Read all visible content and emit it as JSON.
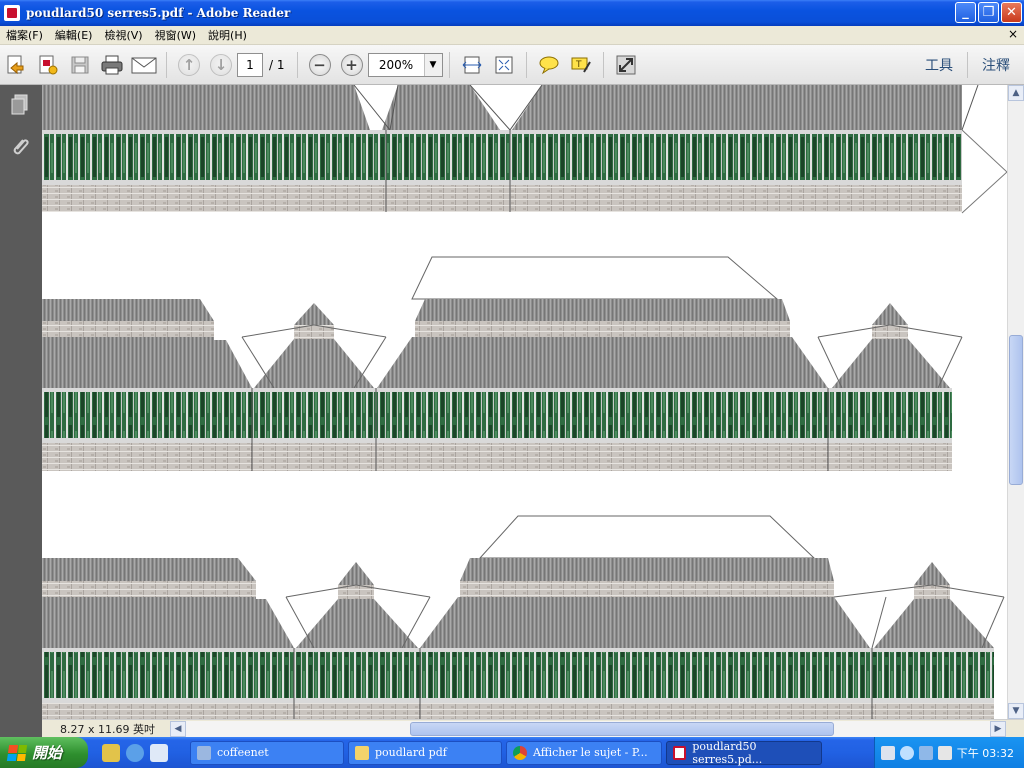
{
  "window": {
    "title": "poudlard50 serres5.pdf - Adobe Reader",
    "buttons": {
      "minimize": "_",
      "restore": "❐",
      "close": "✕"
    }
  },
  "menubar": {
    "items": [
      "檔案(F)",
      "編輯(E)",
      "檢視(V)",
      "視窗(W)",
      "說明(H)"
    ],
    "close_glyph": "×"
  },
  "toolbar": {
    "page_current": "1",
    "page_total": "/ 1",
    "zoom": "200%",
    "tools_label": "工具",
    "comment_label": "注釋"
  },
  "status": {
    "page_size": "8.27 x 11.69 英吋"
  },
  "taskbar": {
    "start_label": "開始",
    "tasks": [
      {
        "label": "coffeenet"
      },
      {
        "label": "poudlard pdf"
      },
      {
        "label": "Afficher le sujet - P..."
      },
      {
        "label": "poudlard50 serres5.pd..."
      }
    ],
    "clock": "下午 03:32"
  },
  "colors": {
    "titlebar": "#0a53e0",
    "roof": "#8d8d8d",
    "glass": "#1f5a34",
    "frame": "#d9d9d9",
    "brick": "#c4c0bc"
  }
}
